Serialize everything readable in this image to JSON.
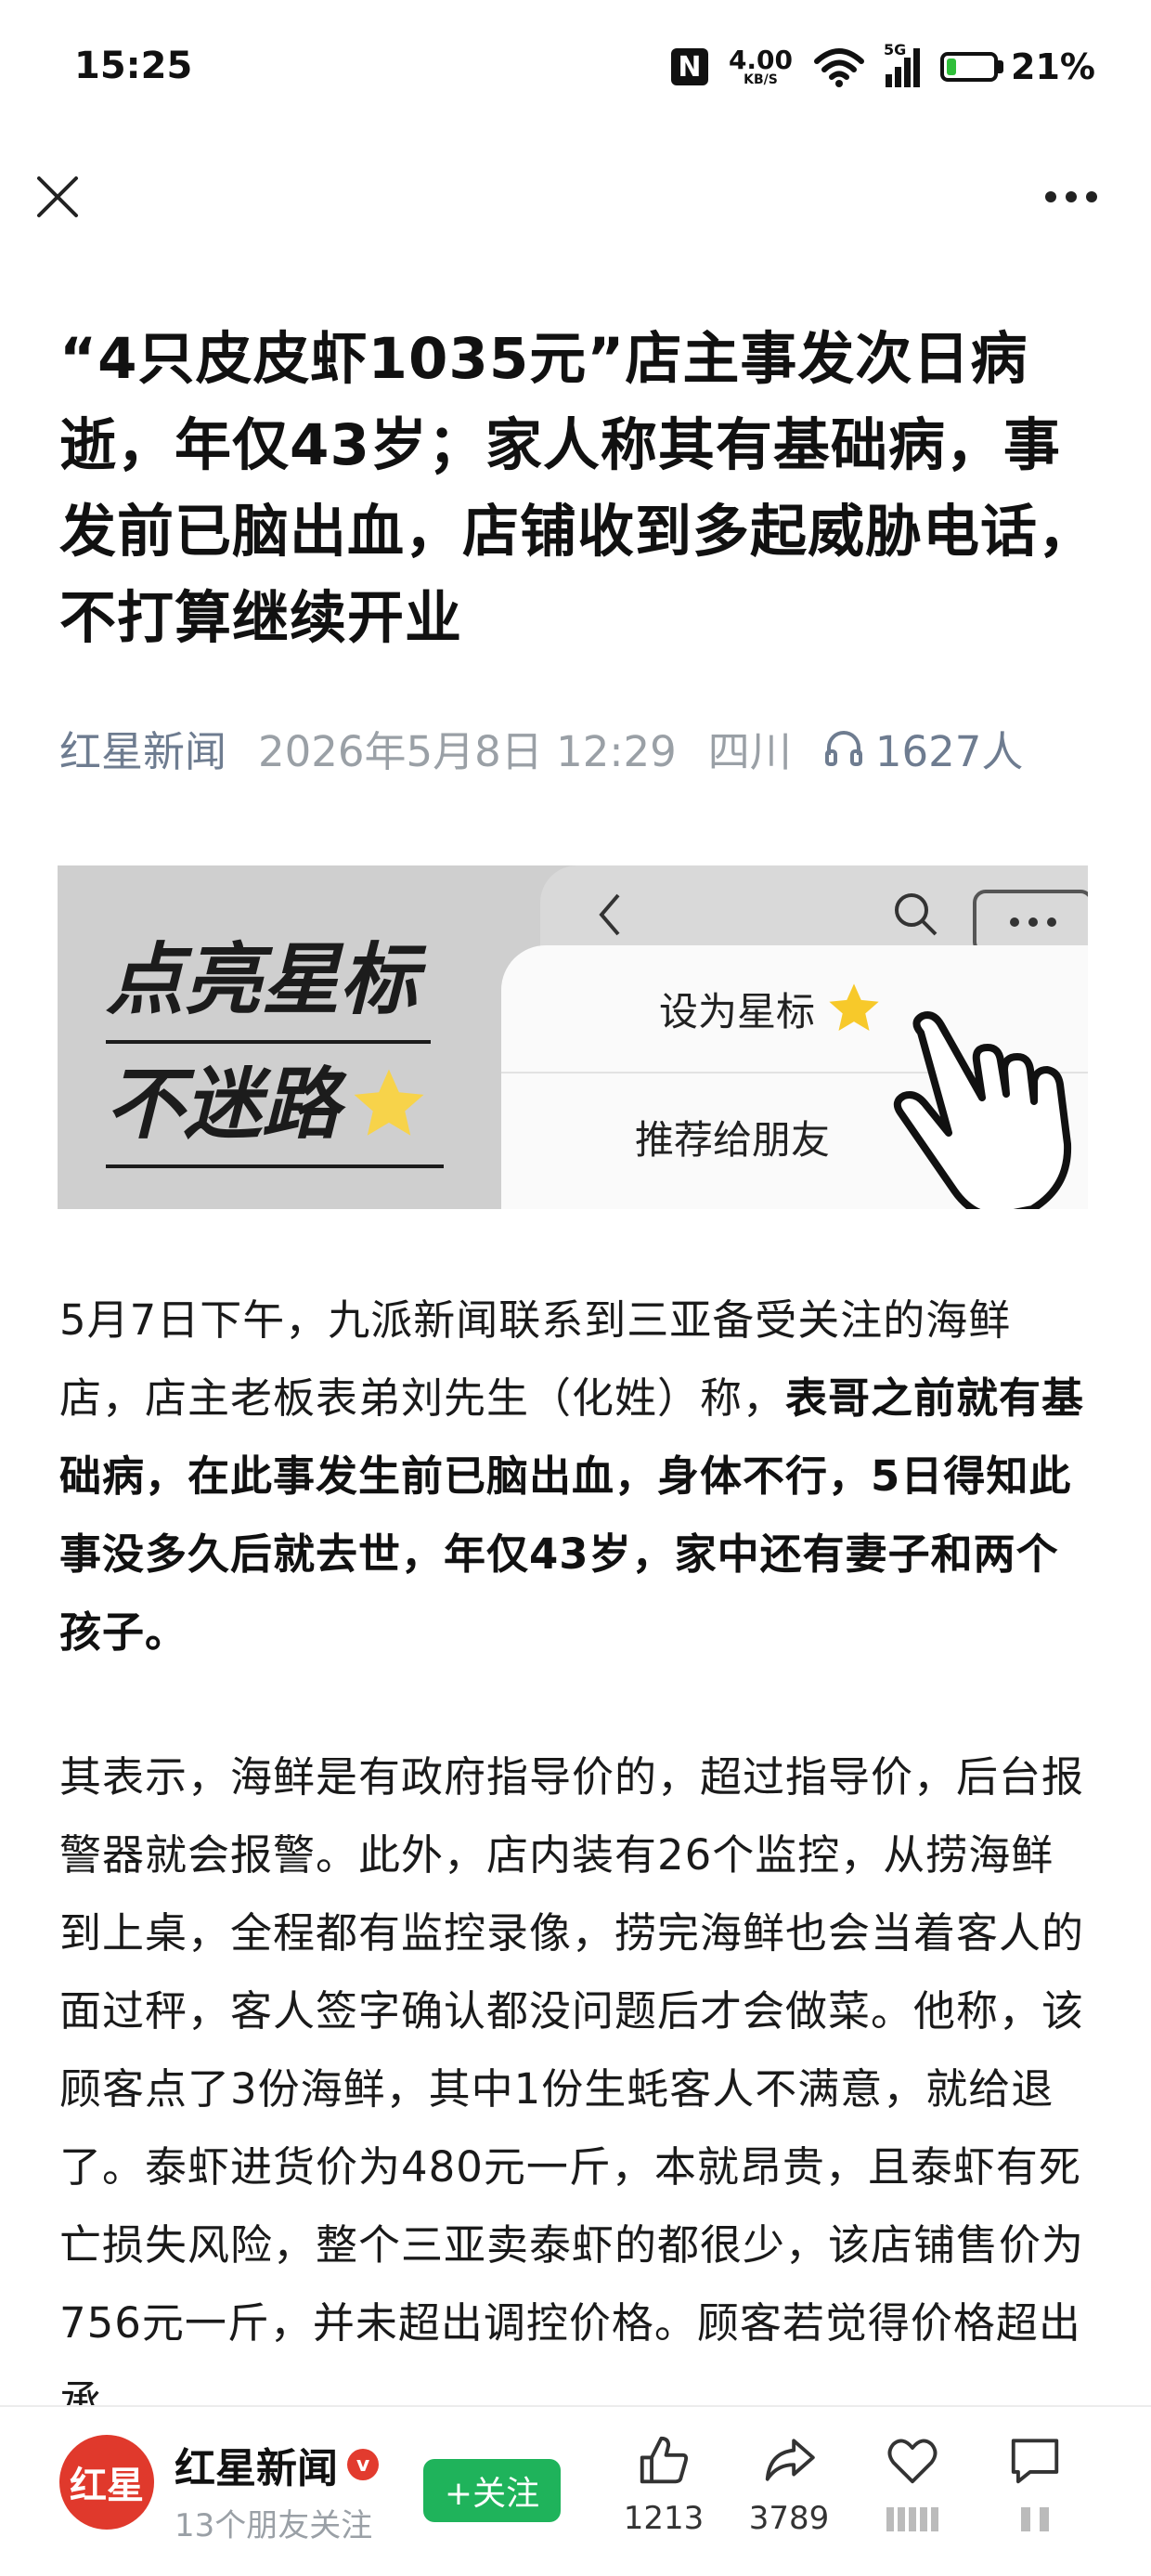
{
  "status_bar": {
    "time": "15:25",
    "nfc_label": "N",
    "net_speed": "4.00",
    "net_unit": "KB/S",
    "signal_label": "5G",
    "battery_percent": "21%",
    "battery_level": 0.21
  },
  "nav": {
    "close_icon": "close-icon",
    "more_icon": "more-icon"
  },
  "article": {
    "headline": "“4只皮皮虾1035元”店主事发次日病逝，年仅43岁；家人称其有基础病，事发前已脑出血，店铺收到多起威胁电话，不打算继续开业",
    "source": "红星新闻",
    "datetime": "2026年5月8日 12:29",
    "region": "四川",
    "listen_count": "1627人",
    "banner": {
      "slogan_line1": "点亮星标",
      "slogan_line2": "不迷路",
      "menu_item1": "设为星标",
      "menu_item2": "推荐给朋友"
    },
    "para1_normal": "5月7日下午，九派新闻联系到三亚备受关注的海鲜店，店主老板表弟刘先生（化姓）称，",
    "para1_bold": "表哥之前就有基础病，在此事发生前已脑出血，身体不行，5日得知此事没多久后就去世，年仅43岁，家中还有妻子和两个孩子。",
    "para2": "其表示，海鲜是有政府指导价的，超过指导价，后台报警器就会报警。此外，店内装有26个监控，从捞海鲜到上桌，全程都有监控录像，捞完海鲜也会当着客人的面过秤，客人签字确认都没问题后才会做菜。他称，该顾客点了3份海鲜，其中1份生蚝客人不满意，就给退了。泰虾进货价为480元一斤，本就昂贵，且泰虾有死亡损失风险，整个三亚卖泰虾的都很少，该店铺售价为756元一斤，并未超出调控价格。顾客若觉得价格超出承"
  },
  "bottom_bar": {
    "avatar_text": "红星",
    "account_name": "红星新闻",
    "verified_badge": "v",
    "friends_following": "13个朋友关注",
    "follow_label": "+关注",
    "like_count": "1213",
    "share_count": "3789",
    "accent_green": "#1fb35b",
    "brand_red": "#e0392c"
  }
}
